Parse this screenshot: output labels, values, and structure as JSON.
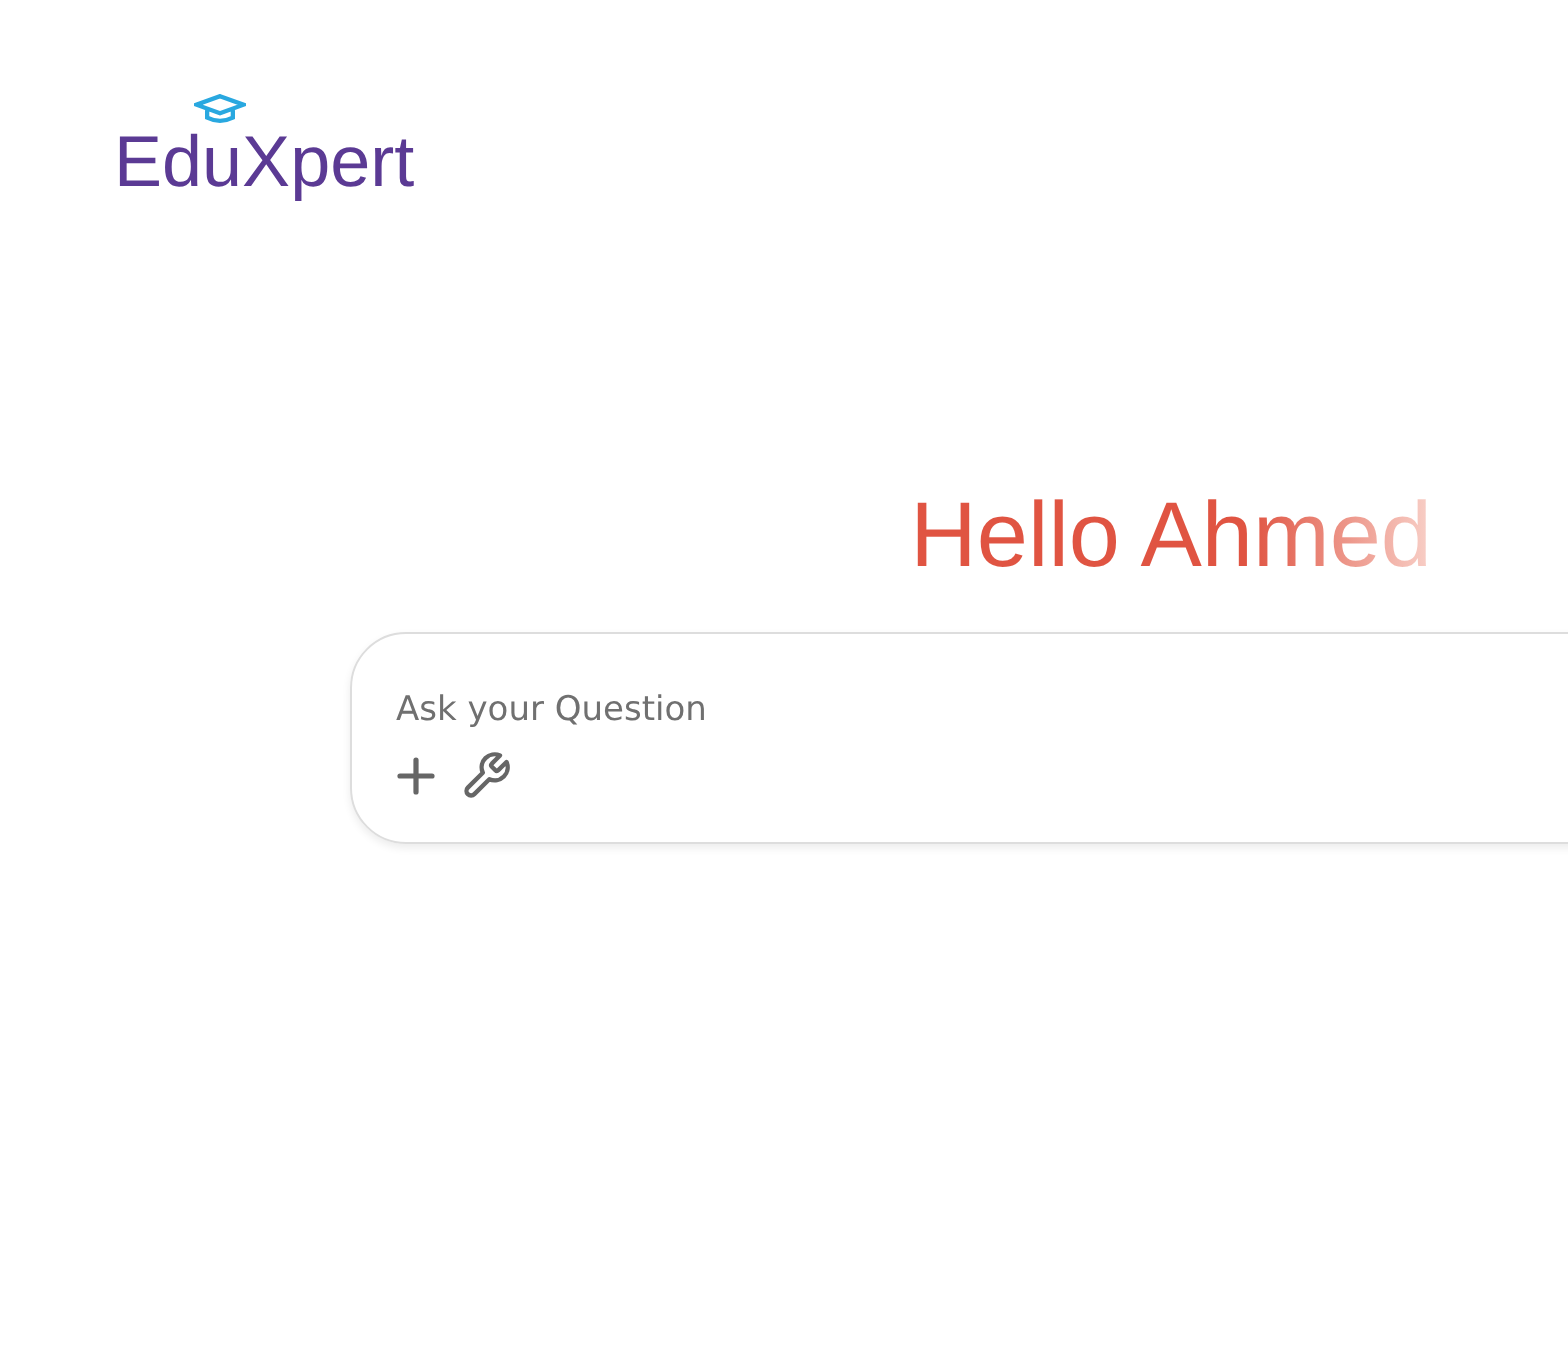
{
  "logo": {
    "text": "EduXpert"
  },
  "greeting": "Hello Ahmed",
  "question_box": {
    "placeholder": "Ask your Question"
  }
}
